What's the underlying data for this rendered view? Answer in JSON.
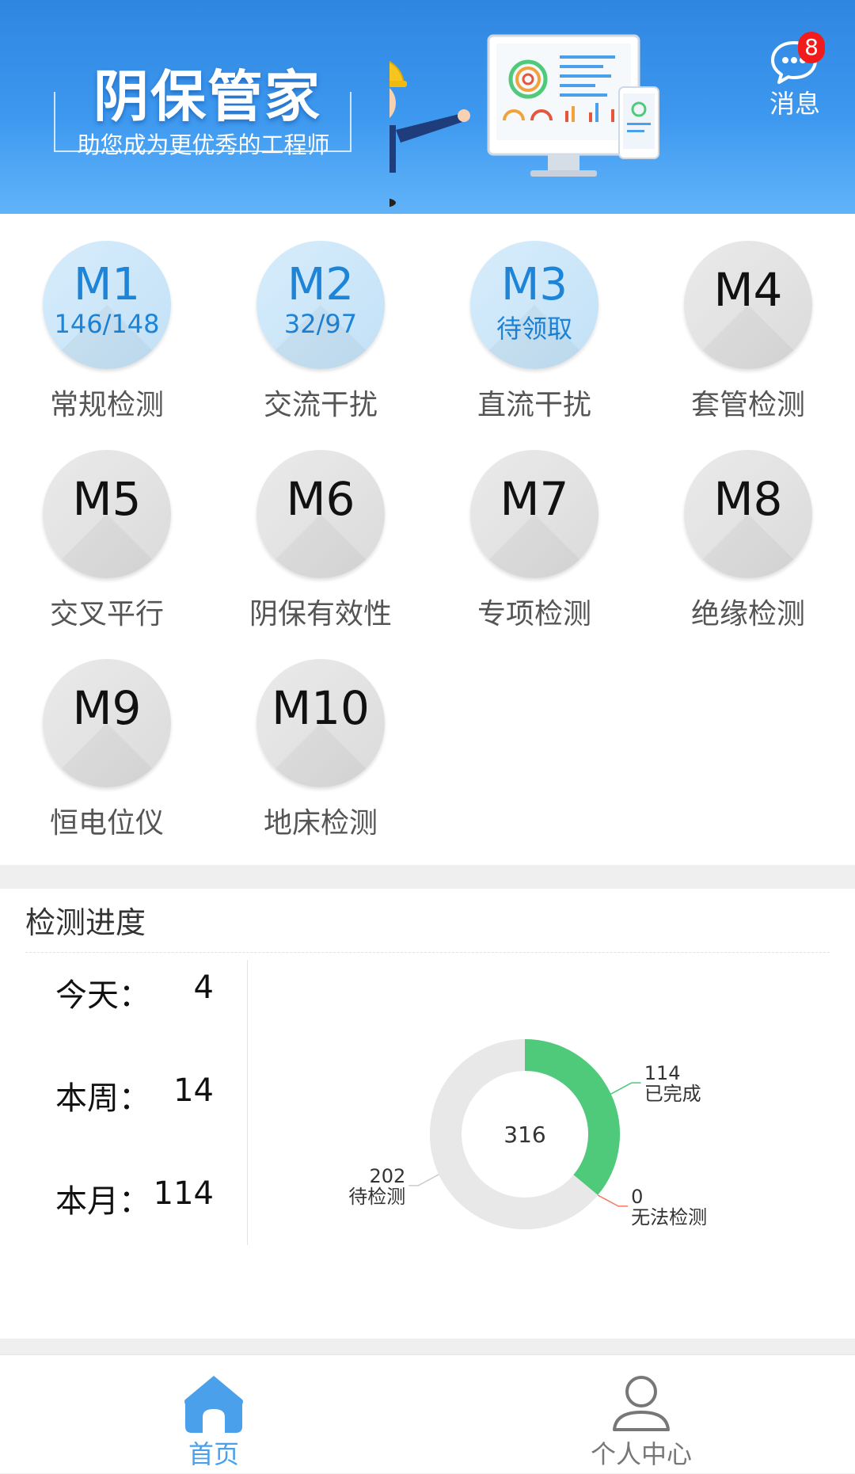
{
  "header": {
    "title": "阴保管家",
    "subtitle": "助您成为更优秀的工程师",
    "message_label": "消息",
    "message_badge": "8"
  },
  "modules": [
    {
      "code": "M1",
      "sub": "146/148",
      "name": "常规检测",
      "active": true
    },
    {
      "code": "M2",
      "sub": "32/97",
      "name": "交流干扰",
      "active": true
    },
    {
      "code": "M3",
      "sub": "待领取",
      "name": "直流干扰",
      "active": true
    },
    {
      "code": "M4",
      "sub": "",
      "name": "套管检测",
      "active": false
    },
    {
      "code": "M5",
      "sub": "",
      "name": "交叉平行",
      "active": false
    },
    {
      "code": "M6",
      "sub": "",
      "name": "阴保有效性",
      "active": false
    },
    {
      "code": "M7",
      "sub": "",
      "name": "专项检测",
      "active": false
    },
    {
      "code": "M8",
      "sub": "",
      "name": "绝缘检测",
      "active": false
    },
    {
      "code": "M9",
      "sub": "",
      "name": "恒电位仪",
      "active": false
    },
    {
      "code": "M10",
      "sub": "",
      "name": "地床检测",
      "active": false
    }
  ],
  "progress": {
    "title": "检测进度",
    "stats": [
      {
        "label": "今天：",
        "value": "4"
      },
      {
        "label": "本周：",
        "value": "14"
      },
      {
        "label": "本月：",
        "value": "114"
      }
    ]
  },
  "chart_data": {
    "type": "pie",
    "total": 316,
    "center_label": "316",
    "slices": [
      {
        "name": "已完成",
        "value": 114,
        "color": "#4fc97a"
      },
      {
        "name": "无法检测",
        "value": 0,
        "color": "#f07a62"
      },
      {
        "name": "待检测",
        "value": 202,
        "color": "#e8e8e8"
      }
    ]
  },
  "nav": {
    "home_label": "首页",
    "profile_label": "个人中心",
    "active_color": "#4aa0ea"
  }
}
